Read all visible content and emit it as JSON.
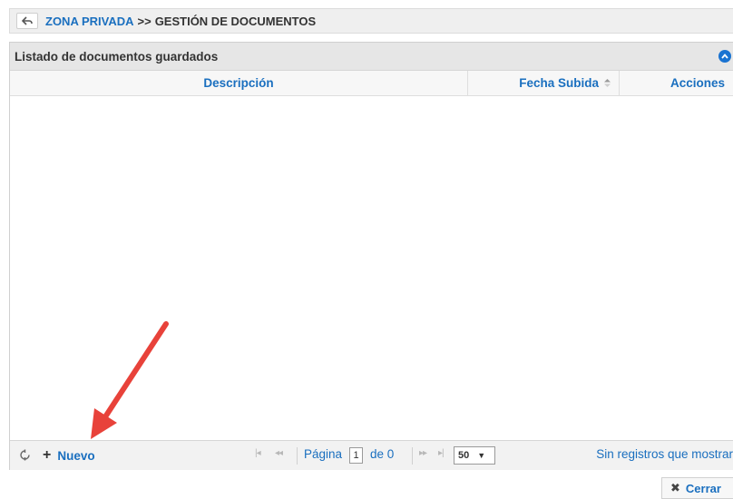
{
  "breadcrumb": {
    "back_icon": "back-arrow-icon",
    "zone_link": "ZONA PRIVADA",
    "separator": ">>",
    "current": "GESTIÓN DE DOCUMENTOS"
  },
  "panel": {
    "title": "Listado de documentos guardados",
    "collapse_icon": "collapse-circle-icon",
    "columns": {
      "descripcion": "Descripción",
      "fecha": "Fecha Subida",
      "acciones": "Acciones"
    }
  },
  "pager": {
    "refresh_icon": "refresh-icon",
    "new_label": "Nuevo",
    "new_icon": "+",
    "first_icon": "|◂",
    "prev_icon": "◂◂",
    "page_label": "Página",
    "page_value": "1",
    "page_of": "de 0",
    "next_icon": "▸▸",
    "last_icon": "▸|",
    "rows_per_page": "50",
    "status": "Sin registros que mostrar"
  },
  "footer": {
    "close_label": "Cerrar",
    "close_icon": "✖"
  },
  "colors": {
    "link": "#1a6fbf",
    "annotation_arrow": "#e8423a"
  }
}
